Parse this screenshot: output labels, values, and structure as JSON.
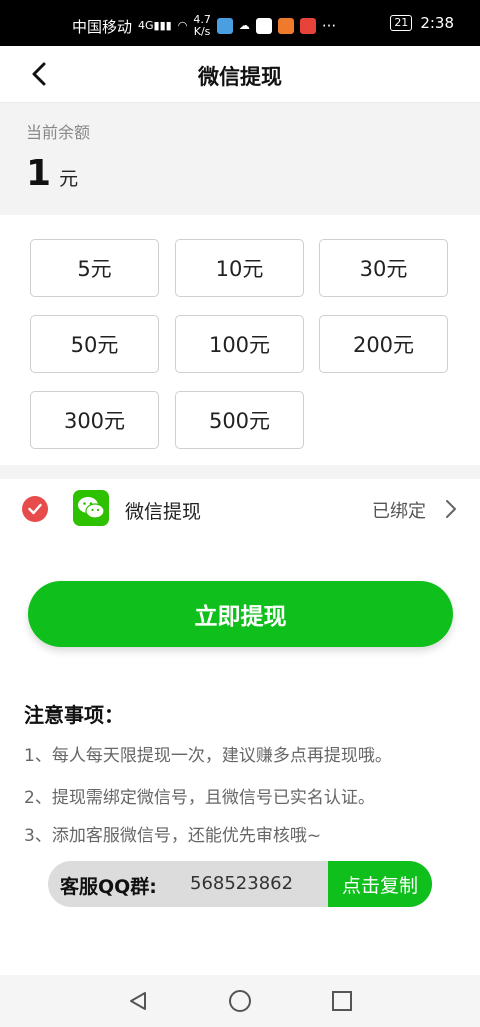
{
  "status_bar": {
    "carrier": "中国移动",
    "network": "4G",
    "speed_value": "4.7",
    "speed_unit": "K/s",
    "battery": "21",
    "time": "2:38"
  },
  "header": {
    "title": "微信提现"
  },
  "balance": {
    "label": "当前余额",
    "amount": "1",
    "unit": "元"
  },
  "amount_options": [
    "5元",
    "10元",
    "30元",
    "50元",
    "100元",
    "200元",
    "300元",
    "500元"
  ],
  "payment": {
    "label": "微信提现",
    "status": "已绑定"
  },
  "withdraw_button": "立即提现",
  "notes": {
    "title": "注意事项：",
    "items": [
      "1、每人每天限提现一次，建议赚多点再提现哦。",
      "2、提现需绑定微信号，且微信号已实名认证。",
      "3、添加客服微信号，还能优先审核哦~"
    ]
  },
  "qq_group": {
    "label": "客服QQ群:",
    "number": "568523862",
    "copy_label": "点击复制"
  },
  "colors": {
    "accent": "#0fbf1b",
    "check": "#e84b4b",
    "wechat": "#2dc100"
  },
  "icons": [
    "back-arrow-icon",
    "check-icon",
    "wechat-icon",
    "chevron-right-icon",
    "nav-back-icon",
    "nav-home-icon",
    "nav-recents-icon"
  ]
}
